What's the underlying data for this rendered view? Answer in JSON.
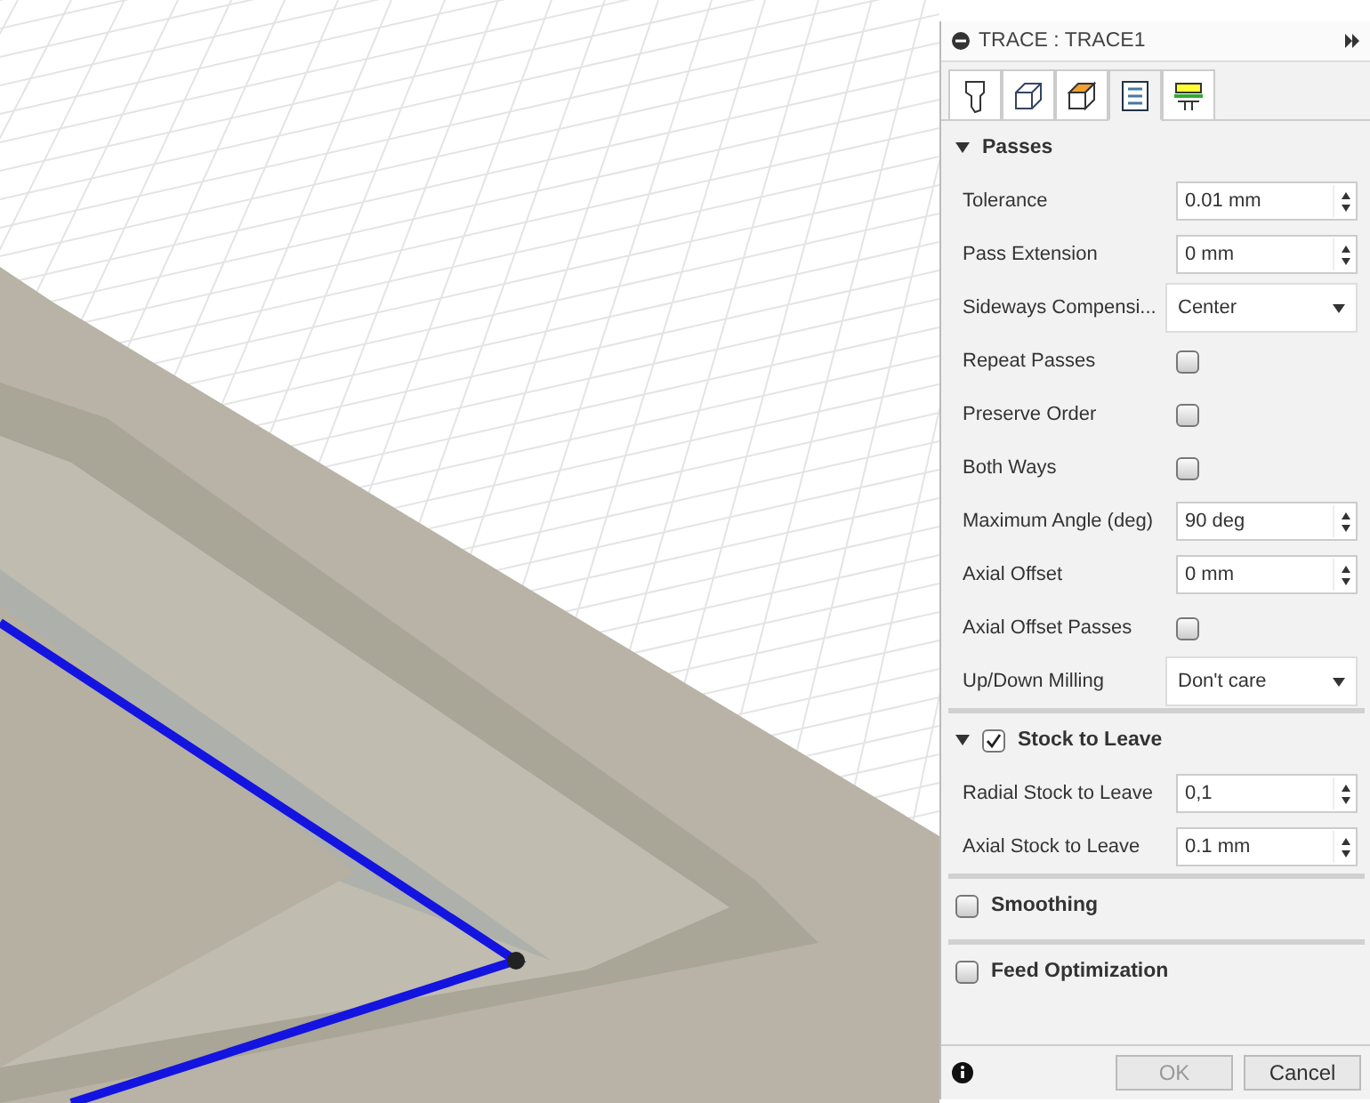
{
  "panel": {
    "title": "TRACE : TRACE1",
    "tabs": [
      {
        "selected": false
      },
      {
        "selected": false
      },
      {
        "selected": false
      },
      {
        "selected": true
      },
      {
        "selected": false
      }
    ],
    "sections": [
      {
        "kind": "plain",
        "title": "Passes",
        "expanded": true,
        "rows": [
          {
            "kind": "number",
            "label": "Tolerance",
            "value": "0.01 mm"
          },
          {
            "kind": "number",
            "label": "Pass Extension",
            "value": "0 mm"
          },
          {
            "kind": "dropdown",
            "label": "Sideways Compensi...",
            "value": "Center"
          },
          {
            "kind": "checkbox",
            "label": "Repeat Passes",
            "checked": false
          },
          {
            "kind": "checkbox",
            "label": "Preserve Order",
            "checked": false
          },
          {
            "kind": "checkbox",
            "label": "Both Ways",
            "checked": false
          },
          {
            "kind": "number",
            "label": "Maximum Angle (deg)",
            "value": "90 deg"
          },
          {
            "kind": "number",
            "label": "Axial Offset",
            "value": "0 mm"
          },
          {
            "kind": "checkbox",
            "label": "Axial Offset Passes",
            "checked": false
          },
          {
            "kind": "dropdown",
            "label": "Up/Down Milling",
            "value": "Don't care"
          }
        ]
      },
      {
        "kind": "checkable",
        "title": "Stock to Leave",
        "expanded": true,
        "checked": true,
        "rows": [
          {
            "kind": "number",
            "label": "Radial Stock to Leave",
            "value": "0,1"
          },
          {
            "kind": "number",
            "label": "Axial Stock to Leave",
            "value": "0.1 mm"
          }
        ]
      },
      {
        "kind": "checkable",
        "title": "Smoothing",
        "expanded": false,
        "checked": false
      },
      {
        "kind": "checkable",
        "title": "Feed Optimization",
        "expanded": false,
        "checked": false
      }
    ],
    "buttons": [
      {
        "label": "OK",
        "disabled": true
      },
      {
        "label": "Cancel",
        "disabled": false
      }
    ]
  }
}
